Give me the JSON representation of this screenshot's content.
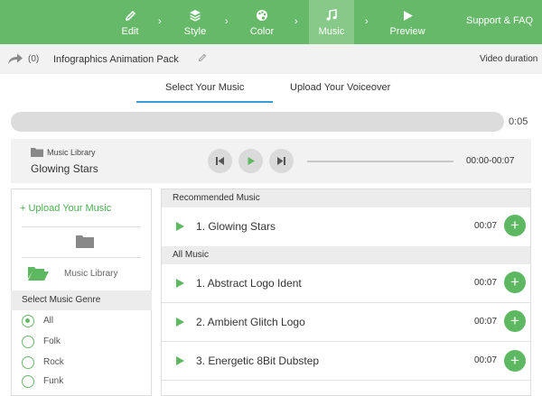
{
  "steps": [
    {
      "label": "Edit",
      "icon": "pencil-icon"
    },
    {
      "label": "Style",
      "icon": "layers-icon"
    },
    {
      "label": "Color",
      "icon": "palette-icon"
    },
    {
      "label": "Music",
      "icon": "music-note-icon",
      "active": true
    },
    {
      "label": "Preview",
      "icon": "play-icon"
    }
  ],
  "support_label": "Support & FAQ",
  "project": {
    "share_count": "(0)",
    "title": "Infographics Animation Pack",
    "duration_label": "Video duration"
  },
  "tabs": [
    {
      "label": "Select Your Music",
      "active": true
    },
    {
      "label": "Upload Your Voiceover",
      "active": false
    }
  ],
  "progress_time": "0:05",
  "player": {
    "library_label": "Music Library",
    "track": "Glowing Stars",
    "time": "00:00-00:07"
  },
  "sidebar": {
    "upload_label": "+ Upload Your Music",
    "library_label": "Music Library",
    "genre_heading": "Select Music Genre",
    "genres": [
      "All",
      "Folk",
      "Rock",
      "Funk"
    ],
    "selected_genre": "All"
  },
  "recommended": {
    "heading": "Recommended Music",
    "tracks": [
      {
        "title": "1. Glowing Stars",
        "time": "00:07"
      }
    ]
  },
  "all_music": {
    "heading": "All Music",
    "tracks": [
      {
        "title": "1. Abstract Logo Ident",
        "time": "00:07"
      },
      {
        "title": "2. Ambient Glitch Logo",
        "time": "00:07"
      },
      {
        "title": "3. Energetic 8Bit Dubstep",
        "time": "00:07"
      }
    ]
  },
  "colors": {
    "accent": "#67b96a",
    "active_step": "#86c989",
    "tab_underline": "#3a9bd5"
  }
}
